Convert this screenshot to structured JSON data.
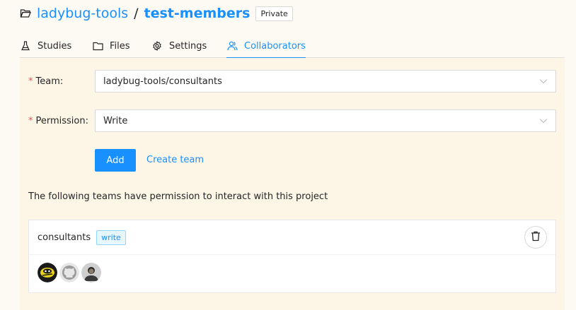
{
  "header": {
    "owner": "ladybug-tools",
    "separator": "/",
    "repo": "test-members",
    "visibility": "Private",
    "icon": "folder-open-icon"
  },
  "tabs": [
    {
      "label": "Studies",
      "icon": "flask-icon",
      "active": false
    },
    {
      "label": "Files",
      "icon": "folder-icon",
      "active": false
    },
    {
      "label": "Settings",
      "icon": "gear-icon",
      "active": false
    },
    {
      "label": "Collaborators",
      "icon": "users-icon",
      "active": true
    }
  ],
  "form": {
    "team_label": "Team",
    "team_value": "ladybug-tools/consultants",
    "permission_label": "Permission",
    "permission_value": "Write",
    "required_mark": "*",
    "label_suffix": ":",
    "add_label": "Add",
    "create_team_label": "Create team"
  },
  "info_text": "The following teams have permission to interact with this project",
  "teams": [
    {
      "name": "consultants",
      "permission": "write",
      "members": [
        "ladybug-avatar",
        "github-avatar",
        "person-avatar"
      ]
    }
  ],
  "colors": {
    "accent": "#1890ff",
    "required": "#ff4d4f",
    "page_bg": "#fdfaf3",
    "panel_bg": "#fdf5e6"
  }
}
